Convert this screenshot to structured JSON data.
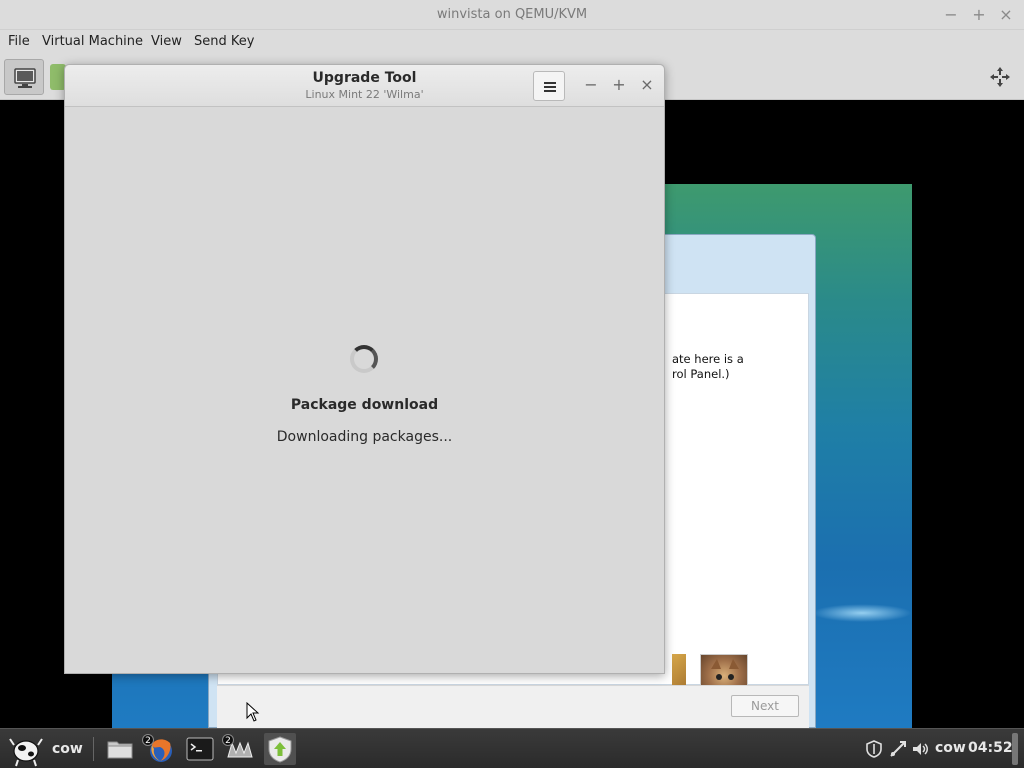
{
  "host_window": {
    "title": "winvista on QEMU/KVM",
    "controls": {
      "minimize": "−",
      "maximize": "+",
      "close": "×"
    },
    "menu": [
      "File",
      "Virtual Machine",
      "View",
      "Send Key"
    ],
    "toolbar": {
      "console_icon": "monitor-icon",
      "details_icon": "lightbulb-icon",
      "fullscreen_icon": "fullscreen-icon"
    }
  },
  "guest": {
    "vista_text": "ate here is a\nrol Panel.)",
    "next_button": "Next"
  },
  "upgrade_tool": {
    "title": "Upgrade Tool",
    "subtitle": "Linux Mint 22 'Wilma'",
    "menu_icon": "hamburger-icon",
    "controls": {
      "minimize": "−",
      "maximize": "+",
      "close": "×"
    },
    "heading": "Package download",
    "status": "Downloading packages..."
  },
  "taskbar": {
    "menu_label": "cow",
    "apps": [
      {
        "name": "files",
        "icon": "folder-icon"
      },
      {
        "name": "firefox",
        "icon": "firefox-icon",
        "badge": "2"
      },
      {
        "name": "terminal",
        "icon": "terminal-icon"
      },
      {
        "name": "virt-manager",
        "icon": "virt-manager-icon",
        "badge": "2"
      },
      {
        "name": "update-manager",
        "icon": "update-shield-icon"
      }
    ],
    "tray": {
      "icons": [
        "shield-icon",
        "network-icon",
        "volume-icon"
      ],
      "user": "cow",
      "clock": "04:52"
    }
  }
}
